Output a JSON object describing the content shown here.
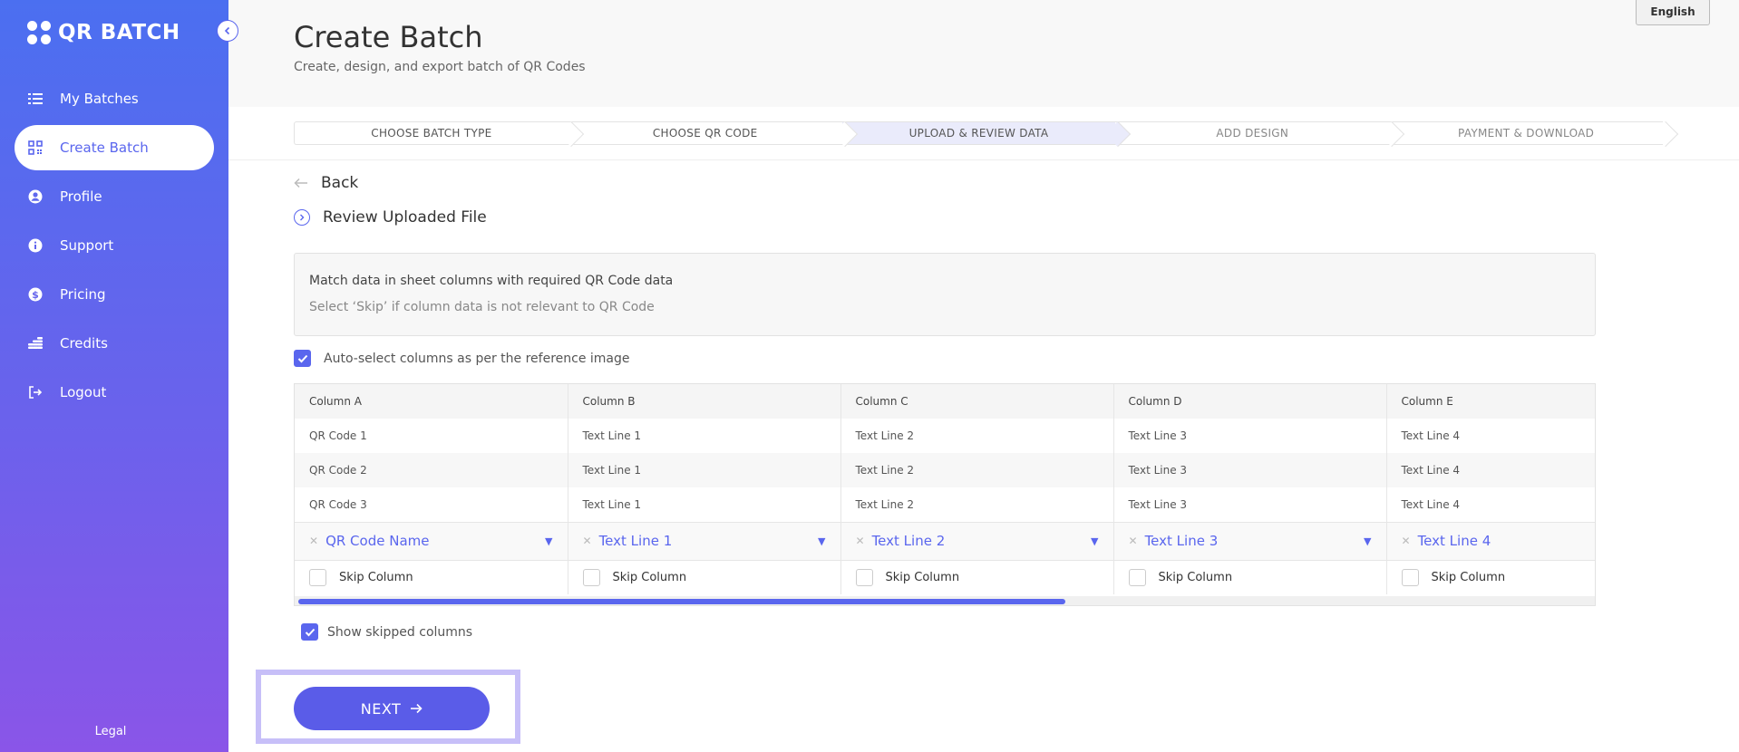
{
  "sidebar": {
    "logo_text": "QR BATCH",
    "items": [
      {
        "label": "My Batches",
        "icon": "list-icon"
      },
      {
        "label": "Create Batch",
        "icon": "qr-icon",
        "active": true
      },
      {
        "label": "Profile",
        "icon": "user-icon"
      },
      {
        "label": "Support",
        "icon": "info-icon"
      },
      {
        "label": "Pricing",
        "icon": "dollar-icon"
      },
      {
        "label": "Credits",
        "icon": "coins-icon"
      },
      {
        "label": "Logout",
        "icon": "logout-icon"
      }
    ],
    "legal": "Legal"
  },
  "header": {
    "title": "Create Batch",
    "subtitle": "Create, design, and export batch of QR Codes",
    "language": "English"
  },
  "stepper": {
    "steps": [
      "CHOOSE BATCH TYPE",
      "CHOOSE QR CODE",
      "UPLOAD & REVIEW DATA",
      "ADD DESIGN",
      "PAYMENT & DOWNLOAD"
    ],
    "active_index": 2
  },
  "back_label": "Back",
  "review_label": "Review Uploaded File",
  "info": {
    "line1": "Match data in sheet columns with required QR Code data",
    "line2": "Select ‘Skip’ if column data is not relevant to QR Code"
  },
  "auto_select": {
    "label": "Auto-select columns as per the reference image",
    "checked": true
  },
  "table": {
    "columns": [
      "Column A",
      "Column B",
      "Column C",
      "Column D",
      "Column E"
    ],
    "rows": [
      [
        "QR Code 1",
        "Text Line 1",
        "Text Line 2",
        "Text Line 3",
        "Text Line 4"
      ],
      [
        "QR Code 2",
        "Text Line 1",
        "Text Line 2",
        "Text Line 3",
        "Text Line 4"
      ],
      [
        "QR Code 3",
        "Text Line 1",
        "Text Line 2",
        "Text Line 3",
        "Text Line 4"
      ]
    ],
    "selections": [
      "QR Code Name",
      "Text Line 1",
      "Text Line 2",
      "Text Line 3",
      "Text Line 4"
    ],
    "skip_label": "Skip Column"
  },
  "show_skipped": {
    "label": "Show skipped columns",
    "checked": true
  },
  "next_label": "NEXT",
  "colors": {
    "accent": "#5a66ee",
    "sidebar_top": "#4b6ff0",
    "sidebar_bottom": "#8a55e8",
    "highlight": "#c7bff8"
  }
}
